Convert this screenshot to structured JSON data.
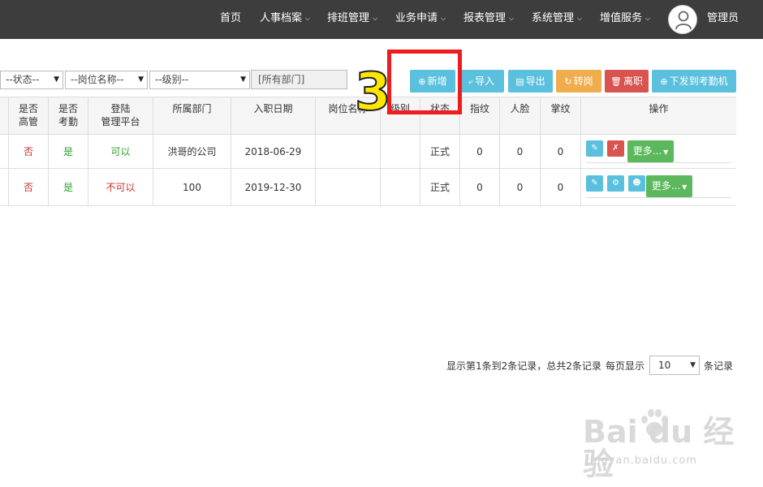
{
  "nav": {
    "items": [
      {
        "label": "首页",
        "caret": false
      },
      {
        "label": "人事档案",
        "caret": true
      },
      {
        "label": "排班管理",
        "caret": true
      },
      {
        "label": "业务申请",
        "caret": true
      },
      {
        "label": "报表管理",
        "caret": true
      },
      {
        "label": "系统管理",
        "caret": true
      },
      {
        "label": "增值服务",
        "caret": true
      }
    ],
    "user_name": "管理员"
  },
  "toolbar": {
    "filters": {
      "status": "--状态--",
      "position": "--岗位名称--",
      "level": "--级别--",
      "department": "[所有部门]"
    },
    "buttons": {
      "add": "新增",
      "import": "导入",
      "export": "导出",
      "transfer": "转岗",
      "resign": "离职",
      "send": "下发到考勤机"
    }
  },
  "table": {
    "headers": {
      "is_manager": "是否\n高管",
      "is_attendance": "是否\n考勤",
      "login": "登陆\n管理平台",
      "department": "所属部门",
      "hire_date": "入职日期",
      "position": "岗位名称",
      "level": "级别",
      "status": "状态",
      "fingerprint": "指纹",
      "face": "人脸",
      "palm": "掌纹",
      "ops": "操作"
    },
    "rows": [
      {
        "is_manager": "否",
        "is_attendance": "是",
        "login": "可以",
        "department": "洪哥的公司",
        "hire_date": "2018-06-29",
        "position": "",
        "level": "",
        "status": "正式",
        "fingerprint": "0",
        "face": "0",
        "palm": "0",
        "more": "更多..."
      },
      {
        "is_manager": "否",
        "is_attendance": "是",
        "login": "不可以",
        "department": "100",
        "hire_date": "2019-12-30",
        "position": "",
        "level": "",
        "status": "正式",
        "fingerprint": "0",
        "face": "0",
        "palm": "0",
        "more": "更多..."
      }
    ]
  },
  "pager": {
    "summary": "显示第1条到2条记录，总共2条记录",
    "per_page_label": "每页显示",
    "per_page": "10",
    "suffix": "条记录"
  },
  "annotation": {
    "step": "3"
  },
  "watermark": {
    "brand": "Bai du 经验",
    "url": "jingyan.baidu.com"
  },
  "colors": {
    "nav_bg": "#3d3d3d",
    "info": "#5bc0de",
    "warning": "#f0ad4e",
    "danger": "#d9534f",
    "success": "#5cb85c",
    "annotation": "#ee1c1c"
  }
}
